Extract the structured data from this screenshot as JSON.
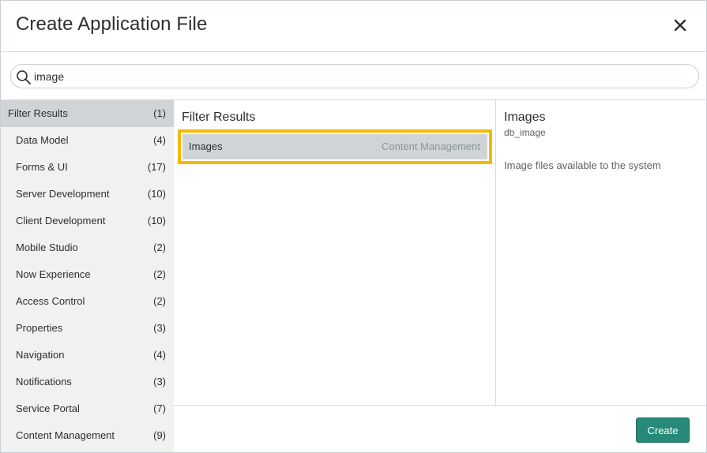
{
  "dialog": {
    "title": "Create Application File",
    "close_icon": "close-icon"
  },
  "search": {
    "icon": "search-icon",
    "value": "image",
    "placeholder": ""
  },
  "categories": [
    {
      "label": "Filter Results",
      "count": "(1)",
      "selected": true
    },
    {
      "label": "Data Model",
      "count": "(4)"
    },
    {
      "label": "Forms & UI",
      "count": "(17)"
    },
    {
      "label": "Server Development",
      "count": "(10)"
    },
    {
      "label": "Client Development",
      "count": "(10)"
    },
    {
      "label": "Mobile Studio",
      "count": "(2)"
    },
    {
      "label": "Now Experience",
      "count": "(2)"
    },
    {
      "label": "Access Control",
      "count": "(2)"
    },
    {
      "label": "Properties",
      "count": "(3)"
    },
    {
      "label": "Navigation",
      "count": "(4)"
    },
    {
      "label": "Notifications",
      "count": "(3)"
    },
    {
      "label": "Service Portal",
      "count": "(7)"
    },
    {
      "label": "Content Management",
      "count": "(9)"
    }
  ],
  "results": {
    "title": "Filter Results",
    "items": [
      {
        "name": "Images",
        "category": "Content Management",
        "selected": true
      }
    ]
  },
  "detail": {
    "title": "Images",
    "id": "db_image",
    "description": "Image files available to the system"
  },
  "footer": {
    "create_label": "Create"
  },
  "colors": {
    "accent": "#278a78",
    "highlight": "#f5b800",
    "selected_bg": "#d0d4d6",
    "sidebar_bg": "#f1f1f1"
  }
}
